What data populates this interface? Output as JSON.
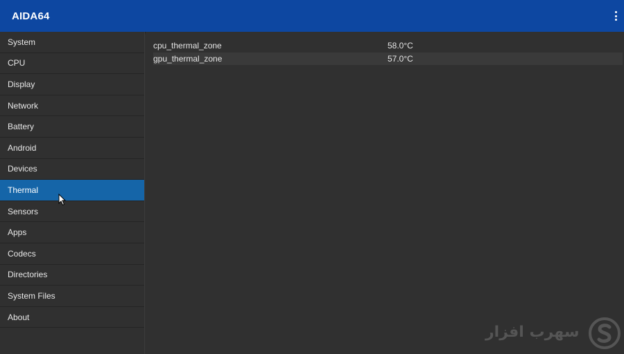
{
  "app": {
    "title": "AIDA64",
    "overflow_icon": "more-vert-icon"
  },
  "sidebar": {
    "items": [
      {
        "label": "System",
        "active": false
      },
      {
        "label": "CPU",
        "active": false
      },
      {
        "label": "Display",
        "active": false
      },
      {
        "label": "Network",
        "active": false
      },
      {
        "label": "Battery",
        "active": false
      },
      {
        "label": "Android",
        "active": false
      },
      {
        "label": "Devices",
        "active": false
      },
      {
        "label": "Thermal",
        "active": true
      },
      {
        "label": "Sensors",
        "active": false
      },
      {
        "label": "Apps",
        "active": false
      },
      {
        "label": "Codecs",
        "active": false
      },
      {
        "label": "Directories",
        "active": false
      },
      {
        "label": "System Files",
        "active": false
      },
      {
        "label": "About",
        "active": false
      }
    ]
  },
  "thermal": {
    "rows": [
      {
        "name": "cpu_thermal_zone",
        "value": "58.0°C"
      },
      {
        "name": "gpu_thermal_zone",
        "value": "57.0°C"
      }
    ]
  },
  "watermark": {
    "text": "سهرب افزار",
    "logo_icon": "s-logo-icon"
  },
  "colors": {
    "appbar": "#0d47a1",
    "background": "#303030",
    "active_item": "#1565a8",
    "row_alt": "#3a3a3a"
  }
}
